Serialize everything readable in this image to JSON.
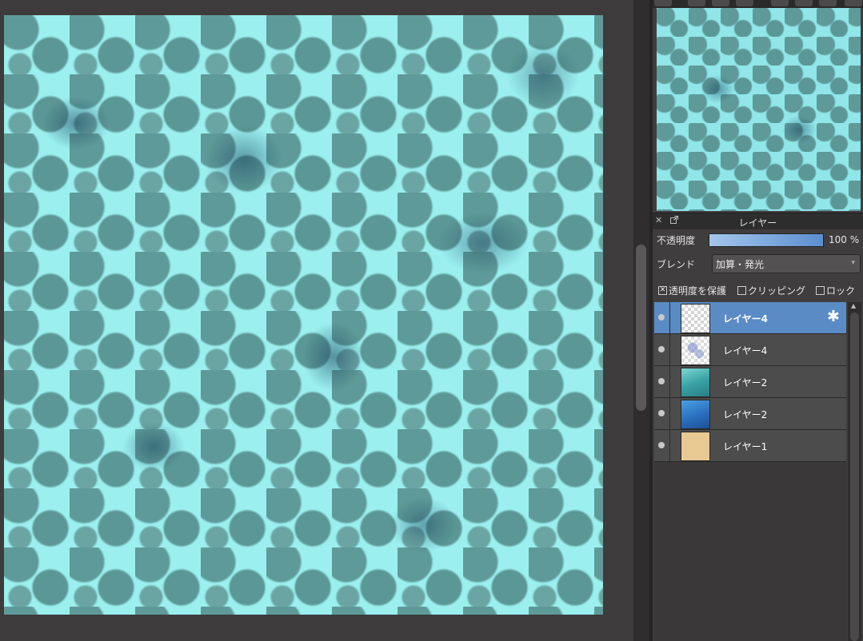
{
  "panel": {
    "layer_title": "レイヤー",
    "opacity": {
      "label": "不透明度",
      "value": 100,
      "value_text": "100 %"
    },
    "blend": {
      "label": "ブレンド",
      "value": "加算・発光"
    },
    "checks": {
      "protect": {
        "label": "透明度を保護",
        "checked": true
      },
      "clipping": {
        "label": "クリッピング",
        "checked": false
      },
      "lock": {
        "label": "ロック",
        "checked": false
      }
    },
    "layers": [
      {
        "name": "レイヤー4",
        "thumb": "transparent",
        "selected": true
      },
      {
        "name": "レイヤー4",
        "thumb": "sketch",
        "selected": false
      },
      {
        "name": "レイヤー2",
        "thumb": "teal",
        "selected": false
      },
      {
        "name": "レイヤー2",
        "thumb": "blue",
        "selected": false
      },
      {
        "name": "レイヤー1",
        "thumb": "beige",
        "selected": false
      }
    ]
  },
  "icons": {
    "close": "close-icon",
    "detach": "detach-icon",
    "settings": "gear-icon",
    "visibility": "eye-icon",
    "dropdown": "chevron-down-icon",
    "scroll_up": "arrow-up-icon"
  },
  "colors": {
    "selected_row": "#5b8bc4",
    "opacity_bar": "#5b8fd0",
    "background": "#3a3838"
  }
}
